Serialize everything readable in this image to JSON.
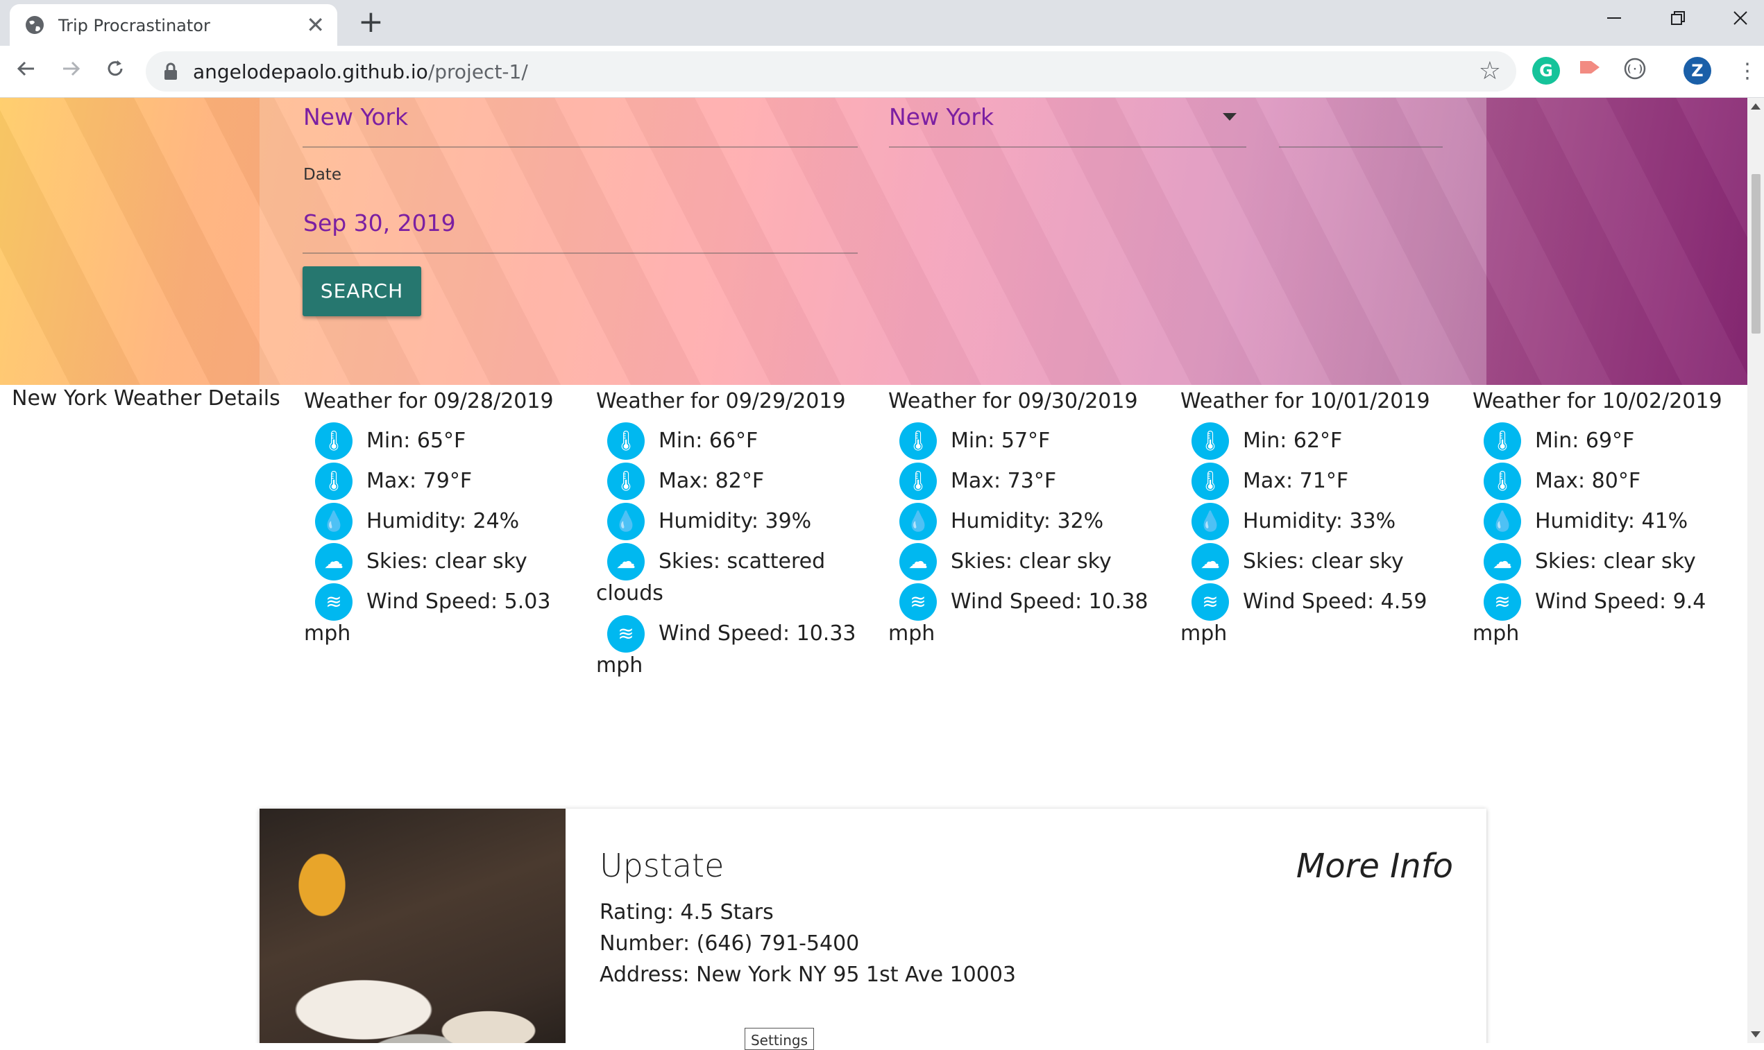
{
  "browser": {
    "tab_title": "Trip Procrastinator",
    "tab_close": "✕",
    "new_tab": "+",
    "url_domain": "angelodepaolo.github.io",
    "url_path": "/project-1/",
    "profile_initial": "Z",
    "extension_grammarly": "G"
  },
  "form": {
    "city_value": "New York",
    "state_value": "New York",
    "date_label": "Date",
    "date_value": "Sep 30, 2019",
    "search_label": "SEARCH"
  },
  "weather": {
    "title": "New York Weather Details",
    "days": [
      {
        "date": "Weather for 09/28/2019",
        "min": "Min: 65°F",
        "max": "Max: 79°F",
        "humidity": "Humidity: 24%",
        "skies": "Skies: clear sky",
        "wind": "Wind Speed: 5.03 mph"
      },
      {
        "date": "Weather for 09/29/2019",
        "min": "Min: 66°F",
        "max": "Max: 82°F",
        "humidity": "Humidity: 39%",
        "skies": "Skies: scattered clouds",
        "wind": "Wind Speed: 10.33 mph"
      },
      {
        "date": "Weather for 09/30/2019",
        "min": "Min: 57°F",
        "max": "Max: 73°F",
        "humidity": "Humidity: 32%",
        "skies": "Skies: clear sky",
        "wind": "Wind Speed: 10.38 mph"
      },
      {
        "date": "Weather for 10/01/2019",
        "min": "Min: 62°F",
        "max": "Max: 71°F",
        "humidity": "Humidity: 33%",
        "skies": "Skies: clear sky",
        "wind": "Wind Speed: 4.59 mph"
      },
      {
        "date": "Weather for 10/02/2019",
        "min": "Min: 69°F",
        "max": "Max: 80°F",
        "humidity": "Humidity: 41%",
        "skies": "Skies: clear sky",
        "wind": "Wind Speed: 9.4 mph"
      }
    ]
  },
  "restaurant": {
    "name": "Upstate",
    "more_info": "More Info",
    "rating": "Rating: 4.5 Stars",
    "number": "Number: (646) 791-5400",
    "address": "Address: New York NY 95 1st Ave 10003"
  },
  "tooltip": "Settings",
  "colors": {
    "accent_button": "#26776f",
    "field_text": "#7b1fa2",
    "weather_icon": "#00b8f0"
  }
}
